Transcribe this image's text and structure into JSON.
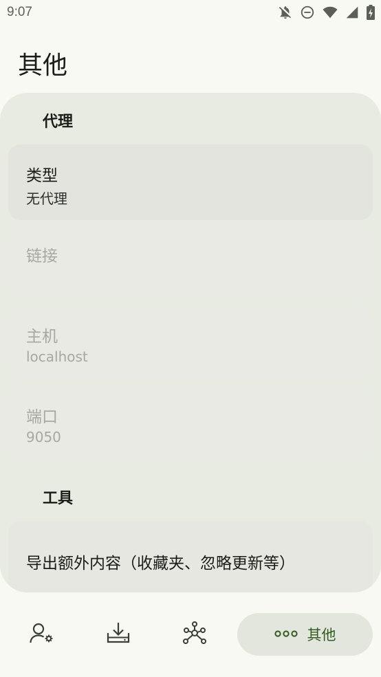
{
  "status_bar": {
    "time": "9:07",
    "icons": [
      "notifications-off-icon",
      "do-not-disturb-icon",
      "wifi-icon",
      "signal-icon",
      "battery-charging-icon"
    ]
  },
  "page": {
    "title": "其他"
  },
  "proxy_section": {
    "header": "代理",
    "items": [
      {
        "title": "类型",
        "value": "无代理",
        "enabled": true
      },
      {
        "title": "链接",
        "value": "",
        "enabled": false
      },
      {
        "title": "主机",
        "value": "localhost",
        "enabled": false
      },
      {
        "title": "端口",
        "value": "9050",
        "enabled": false
      }
    ]
  },
  "tools_section": {
    "header": "工具",
    "items": [
      {
        "title": "导出额外内容（收藏夹、忽略更新等）"
      }
    ]
  },
  "bottom_nav": {
    "items": [
      {
        "icon": "account-settings-icon"
      },
      {
        "icon": "download-icon"
      },
      {
        "icon": "network-icon"
      },
      {
        "icon": "more-horizontal-icon",
        "label": "其他",
        "active": true
      }
    ]
  },
  "colors": {
    "accent": "#2f5d1f",
    "card_bg": "#e8ebe1",
    "page_bg": "#f8f9f3"
  }
}
